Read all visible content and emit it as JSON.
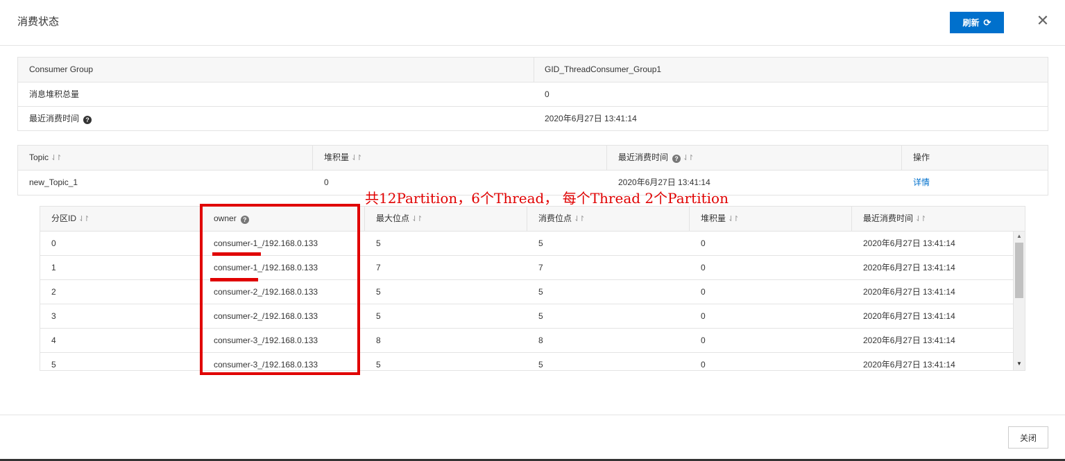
{
  "dialog": {
    "title": "消费状态",
    "refresh_label": "刷新",
    "refresh_icon": "refresh-icon",
    "close_icon": "close-icon",
    "close_label": "关闭",
    "close_glyph": "✕"
  },
  "summary": {
    "rows": [
      {
        "label": "Consumer Group",
        "value": "GID_ThreadConsumer_Group1"
      },
      {
        "label": "消息堆积总量",
        "value": "0"
      },
      {
        "label": "最近消费时间",
        "value": "2020年6月27日 13:41:14"
      }
    ]
  },
  "topic_table": {
    "headers": [
      "Topic",
      "堆积量",
      "最近消费时间",
      "操作"
    ],
    "rows": [
      {
        "topic": "new_Topic_1",
        "backlog": "0",
        "last_time": "2020年6月27日 13:41:14",
        "action": "详情"
      }
    ]
  },
  "partition_table": {
    "headers": [
      "分区ID",
      "owner",
      "最大位点",
      "消费位点",
      "堆积量",
      "最近消费时间"
    ],
    "rows": [
      [
        "0",
        "consumer-1_/192.168.0.133",
        "5",
        "5",
        "0",
        "2020年6月27日 13:41:14"
      ],
      [
        "1",
        "consumer-1_/192.168.0.133",
        "7",
        "7",
        "0",
        "2020年6月27日 13:41:14"
      ],
      [
        "2",
        "consumer-2_/192.168.0.133",
        "5",
        "5",
        "0",
        "2020年6月27日 13:41:14"
      ],
      [
        "3",
        "consumer-2_/192.168.0.133",
        "5",
        "5",
        "0",
        "2020年6月27日 13:41:14"
      ],
      [
        "4",
        "consumer-3_/192.168.0.133",
        "8",
        "8",
        "0",
        "2020年6月27日 13:41:14"
      ],
      [
        "5",
        "consumer-3_/192.168.0.133",
        "5",
        "5",
        "0",
        "2020年6月27日 13:41:14"
      ]
    ]
  },
  "annotation": {
    "text": "共12Partition，6个Thread， 每个Thread 2个Partition",
    "color": "#e00000"
  },
  "colors": {
    "accent": "#0070cc",
    "annotation": "#e00000"
  }
}
